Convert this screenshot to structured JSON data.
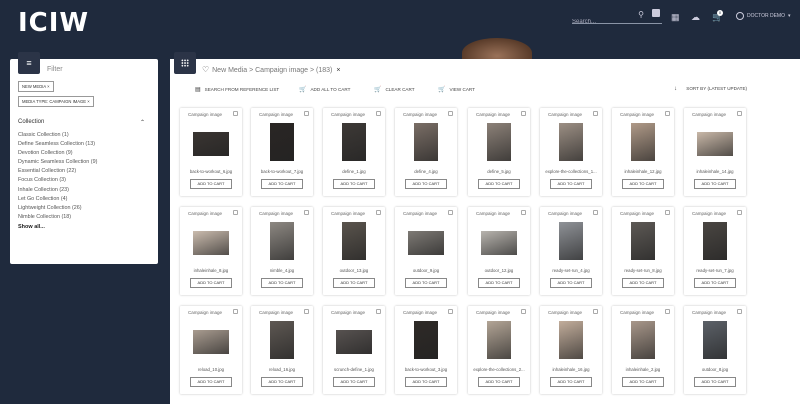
{
  "header": {
    "logo": "ICIW",
    "search_placeholder": "Search...",
    "cart_count": "0",
    "user_name": "DOCTOR DEMO"
  },
  "filter": {
    "title": "Filter",
    "chips": [
      "NEW MEDIA ×",
      "MEDIA TYPE: CAMPAIGN IMAGE ×"
    ],
    "collection_heading": "Collection",
    "collections": [
      "Classic Collection (1)",
      "Define Seamless Collection (13)",
      "Devotion Collection (9)",
      "Dynamic Seamless Collection (9)",
      "Essential Collection (22)",
      "Focus Collection (3)",
      "Inhale Collection (23)",
      "Let Go Collection (4)",
      "Lightweight Collection (26)",
      "Nimble Collection (18)"
    ],
    "show_all": "Show all..."
  },
  "main": {
    "breadcrumb": "New Media > Campaign image > (183)",
    "close": "×",
    "actions": [
      "SEARCH FROM REFERENCE LIST",
      "ADD ALL TO CART",
      "CLEAR CART",
      "VIEW CART"
    ],
    "sort_label": "SORT BY (LATEST UPDATE)",
    "card_type": "Campaign image",
    "add_label": "ADD TO CART",
    "items": [
      {
        "name": "back-to-workout_6.jpg",
        "shape": "wide",
        "color": "#3a3532"
      },
      {
        "name": "back-to-workout_7.jpg",
        "shape": "tall",
        "color": "#2a2624"
      },
      {
        "name": "define_1.jpg",
        "shape": "tall",
        "color": "#3d3936"
      },
      {
        "name": "define_4.jpg",
        "shape": "tall",
        "color": "#7a6e66"
      },
      {
        "name": "define_5.jpg",
        "shape": "tall",
        "color": "#8c8178"
      },
      {
        "name": "explore-the-collections_1...",
        "shape": "tall",
        "color": "#9c8f84"
      },
      {
        "name": "inhaleinhale_12.jpg",
        "shape": "tall",
        "color": "#b09a88"
      },
      {
        "name": "inhaleinhale_14.jpg",
        "shape": "wide",
        "color": "#c9b8a8"
      },
      {
        "name": "inhaleinhale_8.jpg",
        "shape": "wide",
        "color": "#cbbcae"
      },
      {
        "name": "nimble_4.jpg",
        "shape": "tall",
        "color": "#8d8882"
      },
      {
        "name": "outdoor_13.jpg",
        "shape": "tall",
        "color": "#5a544d"
      },
      {
        "name": "outdoor_9.jpg",
        "shape": "wide",
        "color": "#7e7a75"
      },
      {
        "name": "outdoor_12.jpg",
        "shape": "wide",
        "color": "#b8b4ae"
      },
      {
        "name": "ready-set-run_4.jpg",
        "shape": "tall",
        "color": "#8f9297"
      },
      {
        "name": "ready-set-run_8.jpg",
        "shape": "tall",
        "color": "#5d5955"
      },
      {
        "name": "ready-set-run_7.jpg",
        "shape": "tall",
        "color": "#4a4642"
      },
      {
        "name": "reload_10.jpg",
        "shape": "wide",
        "color": "#a99c90"
      },
      {
        "name": "reload_16.jpg",
        "shape": "tall",
        "color": "#5e5853"
      },
      {
        "name": "scrunch-define_1.jpg",
        "shape": "wide",
        "color": "#575250"
      },
      {
        "name": "back-to-workout_3.jpg",
        "shape": "tall",
        "color": "#2e2a27"
      },
      {
        "name": "explore-the-collections_2...",
        "shape": "tall",
        "color": "#b3a596"
      },
      {
        "name": "inhaleinhale_16.jpg",
        "shape": "tall",
        "color": "#c2ad9b"
      },
      {
        "name": "inhaleinhale_2.jpg",
        "shape": "tall",
        "color": "#a8978a"
      },
      {
        "name": "outdoor_8.jpg",
        "shape": "tall",
        "color": "#5c6168"
      }
    ]
  }
}
